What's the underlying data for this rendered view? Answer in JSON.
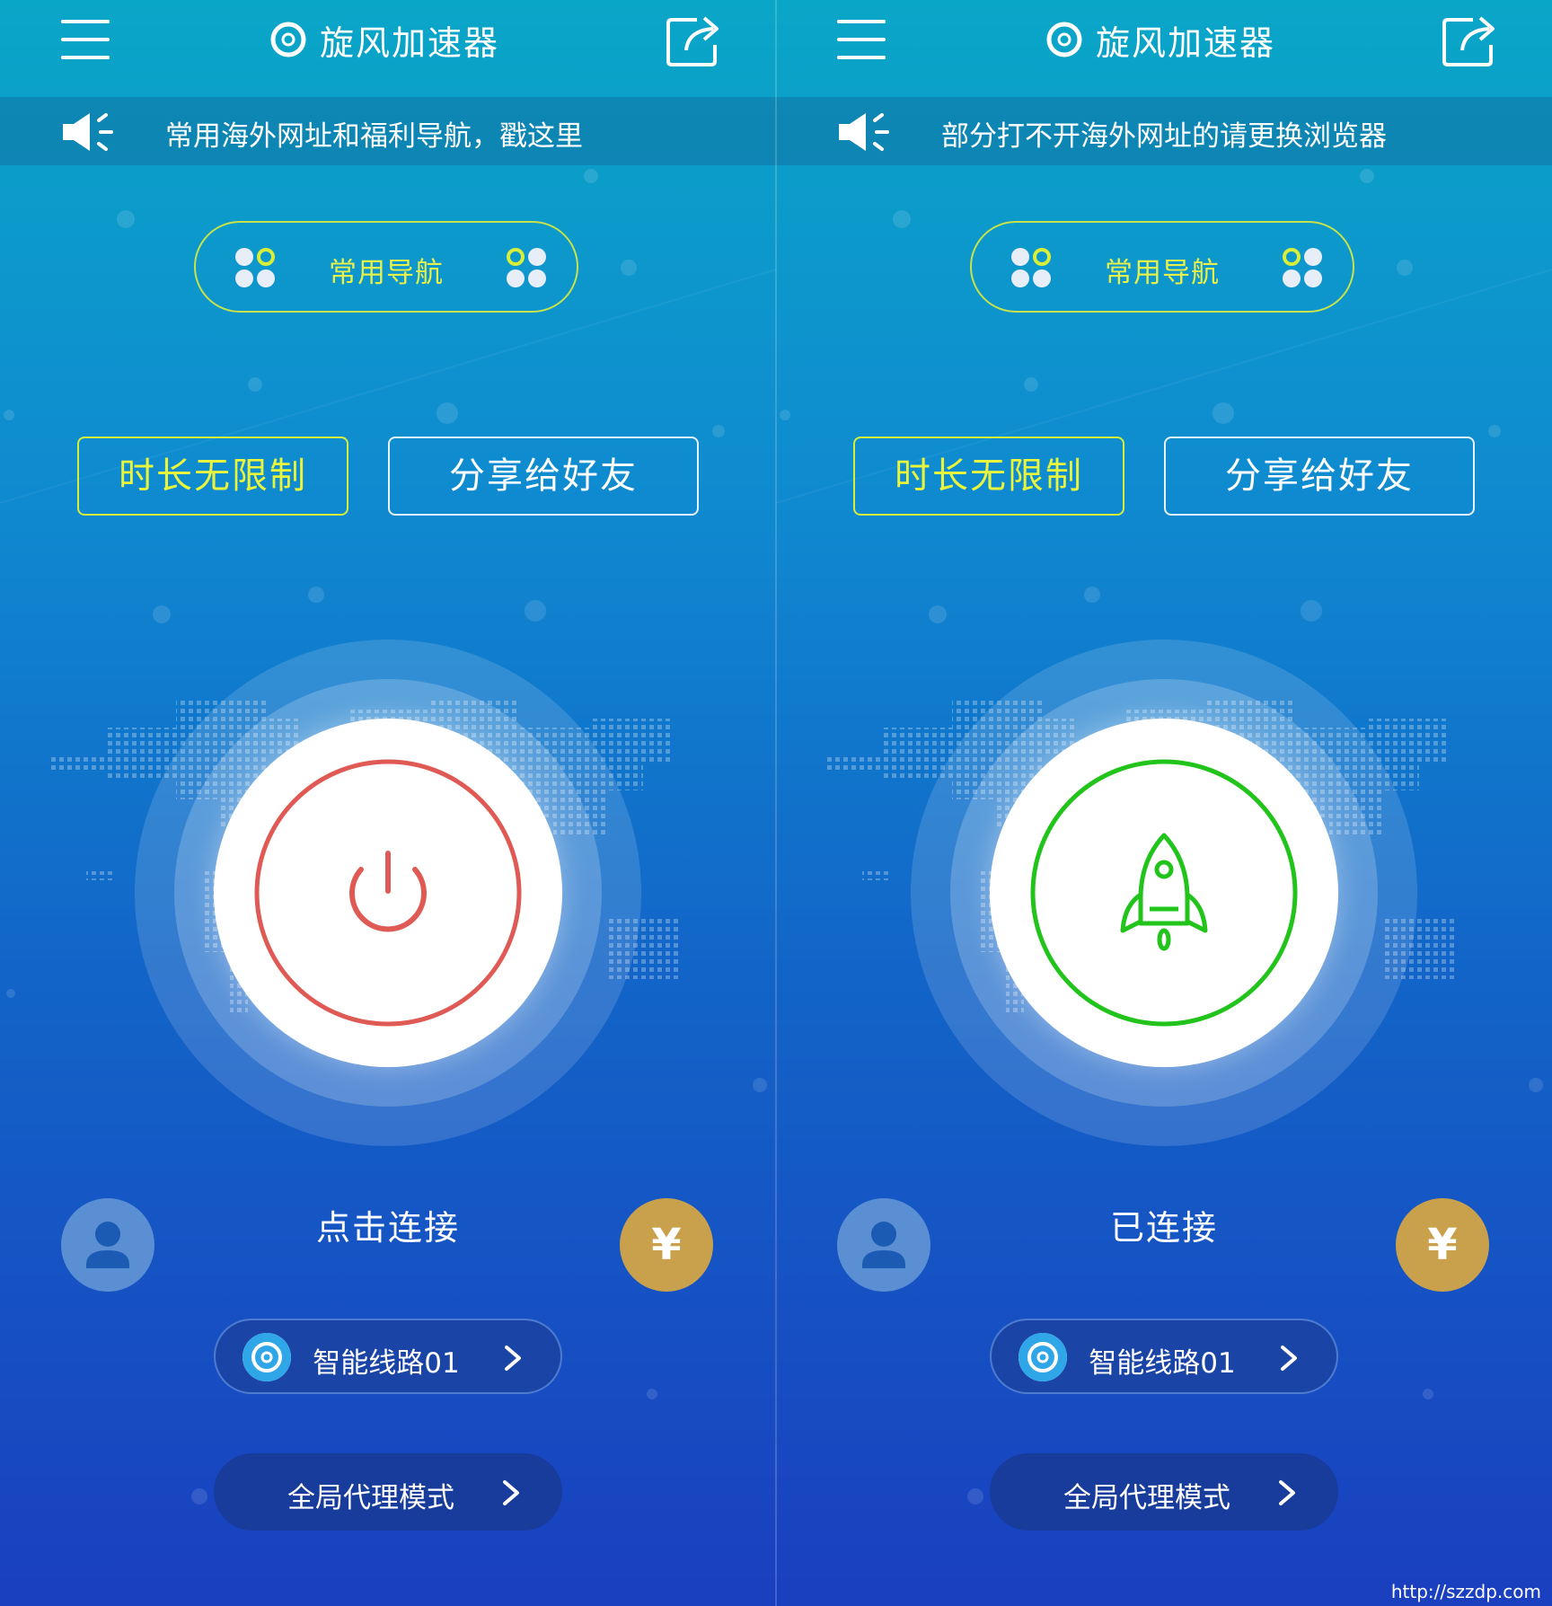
{
  "left_screen": {
    "app_title": "旋风加速器",
    "notice_text": "常用海外网址和福利导航，戳这里",
    "nav_label": "常用导航",
    "promo_unlimited": "时长无限制",
    "promo_share": "分享给好友",
    "status_text": "点击连接",
    "route_label": "智能线路01",
    "mode_label": "全局代理模式",
    "currency_symbol": "¥",
    "connect_state": "disconnected",
    "accent_color": "#e05a55"
  },
  "right_screen": {
    "app_title": "旋风加速器",
    "notice_text": "部分打不开海外网址的请更换浏览器",
    "nav_label": "常用导航",
    "promo_unlimited": "时长无限制",
    "promo_share": "分享给好友",
    "status_text": "已连接",
    "route_label": "智能线路01",
    "mode_label": "全局代理模式",
    "currency_symbol": "¥",
    "connect_state": "connected",
    "accent_color": "#22c41c"
  },
  "watermark": "http://szzdp.com",
  "icons": {
    "menu": "hamburger-icon",
    "share": "share-icon",
    "notice": "speaker-icon",
    "nav": "app-grid-icon",
    "power": "power-icon",
    "rocket": "rocket-icon",
    "avatar": "user-icon",
    "route_logo": "swirl-logo-icon",
    "chevron": "chevron-right-icon"
  },
  "colors": {
    "nav_accent": "#e8f04a",
    "promo_accent": "#e9f43c",
    "yen_button": "#c9a14c",
    "power_ring": "#e05a55",
    "rocket_ring": "#22c41c"
  }
}
